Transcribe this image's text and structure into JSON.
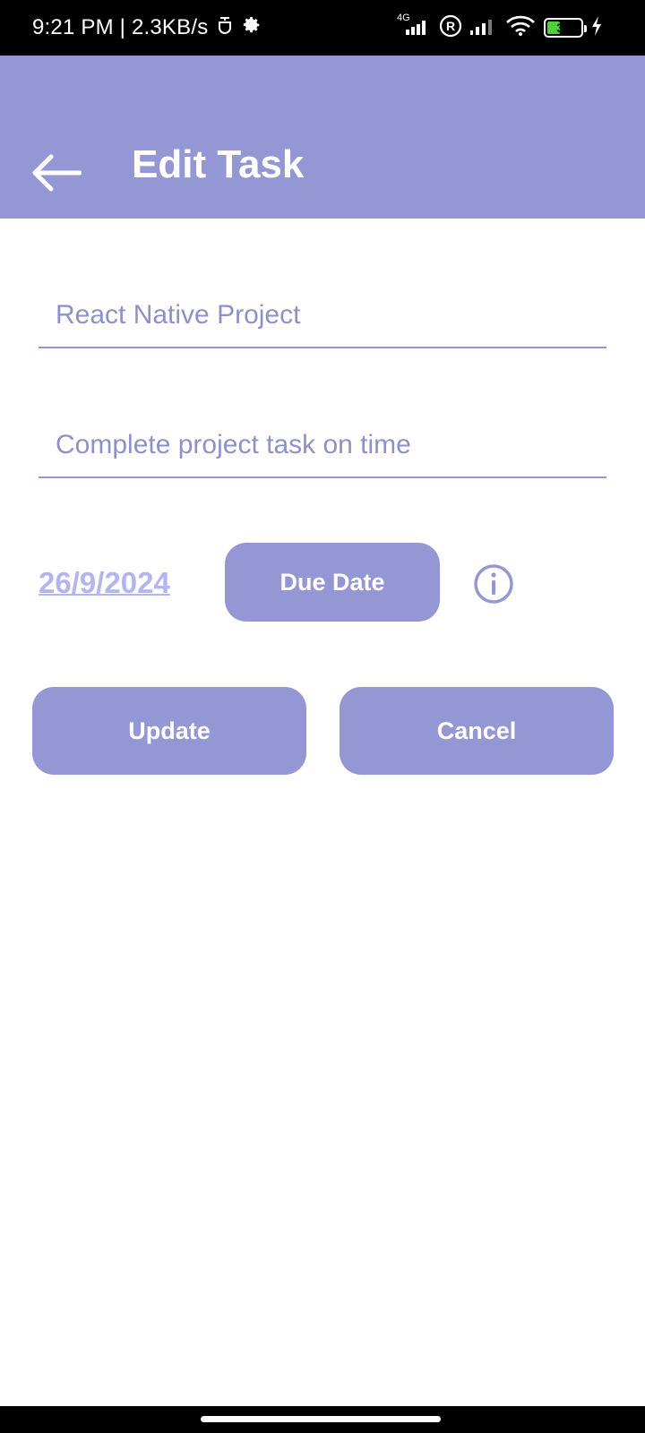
{
  "status_bar": {
    "time_speed": "9:21 PM | 2.3KB/s",
    "network_type": "4G",
    "battery_level": "33",
    "icons": [
      "notification-icon",
      "settings-icon",
      "signal-icon",
      "registered-icon",
      "signal-icon",
      "wifi-icon",
      "battery-icon",
      "charging-icon"
    ]
  },
  "header": {
    "title": "Edit Task",
    "back_icon": "arrow-left-icon"
  },
  "form": {
    "title_placeholder": "React Native Project",
    "description_placeholder": "Complete project task on time",
    "due_date_value": "26/9/2024",
    "due_date_button": "Due Date",
    "info_icon": "info-icon"
  },
  "actions": {
    "update_label": "Update",
    "cancel_label": "Cancel"
  },
  "colors": {
    "accent": "#9497d4",
    "date_text": "#b3b5ee",
    "status_bar": "#000000",
    "background": "#ffffff"
  }
}
